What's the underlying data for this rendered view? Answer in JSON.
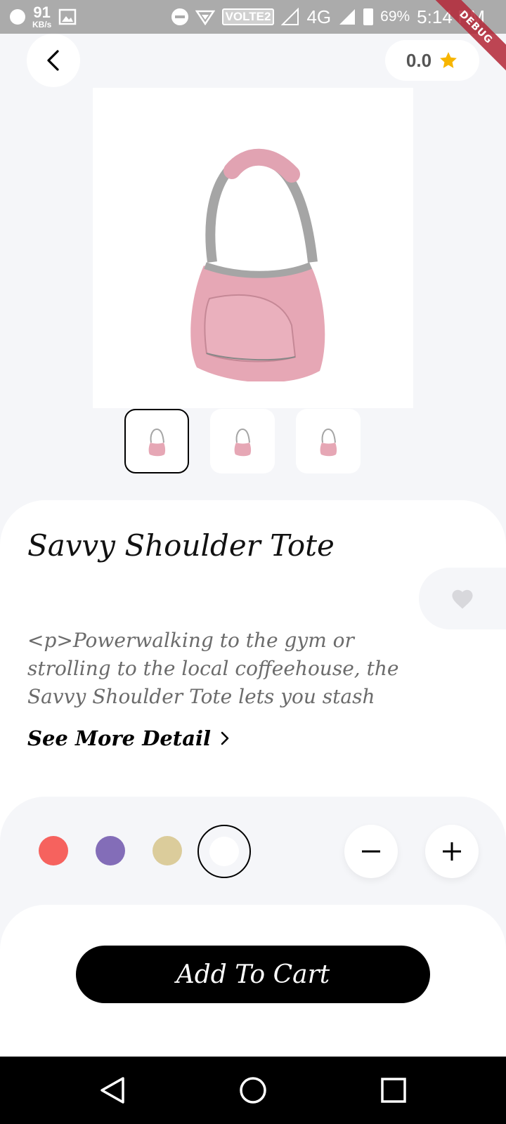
{
  "status_bar": {
    "speed_value": "91",
    "speed_unit": "KB/s",
    "carrier_badge": "VOLTE2",
    "network": "4G",
    "battery": "69%",
    "time": "5:14 PM",
    "debug_label": "DEBUG"
  },
  "header": {
    "rating": "0.0",
    "star_color": "#f7b500"
  },
  "product": {
    "title": "Savvy Shoulder Tote",
    "description": "<p>Powerwalking to the gym or strolling to the local coffeehouse, the Savvy Shoulder Tote lets you stash your",
    "see_more_label": "See More Detail",
    "image_icon": "pink-shoulder-bag",
    "thumbnail_count": 3,
    "active_thumbnail": 0
  },
  "colors": [
    {
      "name": "red",
      "hex": "#f6625e"
    },
    {
      "name": "purple",
      "hex": "#836db8"
    },
    {
      "name": "gold",
      "hex": "#dbcc9b"
    },
    {
      "name": "white",
      "hex": "#ffffff",
      "selected": true
    }
  ],
  "quantity": {
    "decrement_label": "−",
    "increment_label": "+"
  },
  "cart": {
    "button_label": "Add To Cart"
  },
  "nav": {
    "back_icon": "triangle-back-icon",
    "home_icon": "circle-home-icon",
    "recents_icon": "square-recents-icon"
  }
}
